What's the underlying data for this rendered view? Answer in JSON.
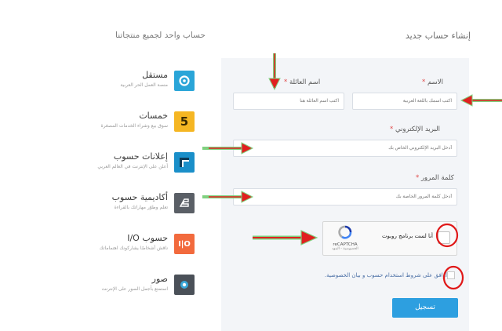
{
  "header": {
    "left_title": "حساب واحد لجميع منتجاتنا",
    "right_title": "إنشاء حساب جديد"
  },
  "products": [
    {
      "name": "مستقل",
      "desc": "منصة العمل الحر العربية",
      "icon": "mostaql-icon",
      "color": "#2aa5d8"
    },
    {
      "name": "خمسات",
      "desc": "سوق بيع وشراء الخدمات المصغرة",
      "icon": "khamsat-icon",
      "color": "#f5b623"
    },
    {
      "name": "إعلانات حسوب",
      "desc": "أعلن على الإنترنت في العالم العربي",
      "icon": "ads-icon",
      "color": "#1a8fc9"
    },
    {
      "name": "أكاديمية حسوب",
      "desc": "تعلم وطوّر مهاراتك بالقراءة",
      "icon": "academy-icon",
      "color": "#5a5f66"
    },
    {
      "name": "حسوب I/O",
      "desc": "ناقش أشخاصًا يشاركونك اهتماماتك",
      "icon": "io-icon",
      "color": "#f26a3d"
    },
    {
      "name": "صور",
      "desc": "استمتع بأجمل الصور على الإنترنت",
      "icon": "photos-icon",
      "color": "#4a5058"
    }
  ],
  "form": {
    "first_name_label": "الاسم",
    "first_name_placeholder": "اكتب اسمك باللغة العربية",
    "family_name_label": "اسم العائلة",
    "family_name_placeholder": "اكتب اسم العائلة هنا",
    "email_label": "البريد الإلكتروني",
    "email_placeholder": "أدخل البريد الإلكتروني الخاص بك",
    "password_label": "كلمة المرور",
    "password_placeholder": "أدخل كلمة المرور الخاصة بك",
    "required_mark": "*"
  },
  "captcha": {
    "text": "أنا لست برنامج روبوت",
    "brand": "reCAPTCHA",
    "terms": "الخصوصية - البنود"
  },
  "terms_text": "أوافق على شروط استخدام حسوب و بيان الخصوصية.",
  "submit_label": "تسجيل",
  "colors": {
    "accent": "#2d9fe0",
    "arrow_red": "#e02020",
    "arrow_green": "#7fd17f",
    "circle_red": "#e01818"
  }
}
